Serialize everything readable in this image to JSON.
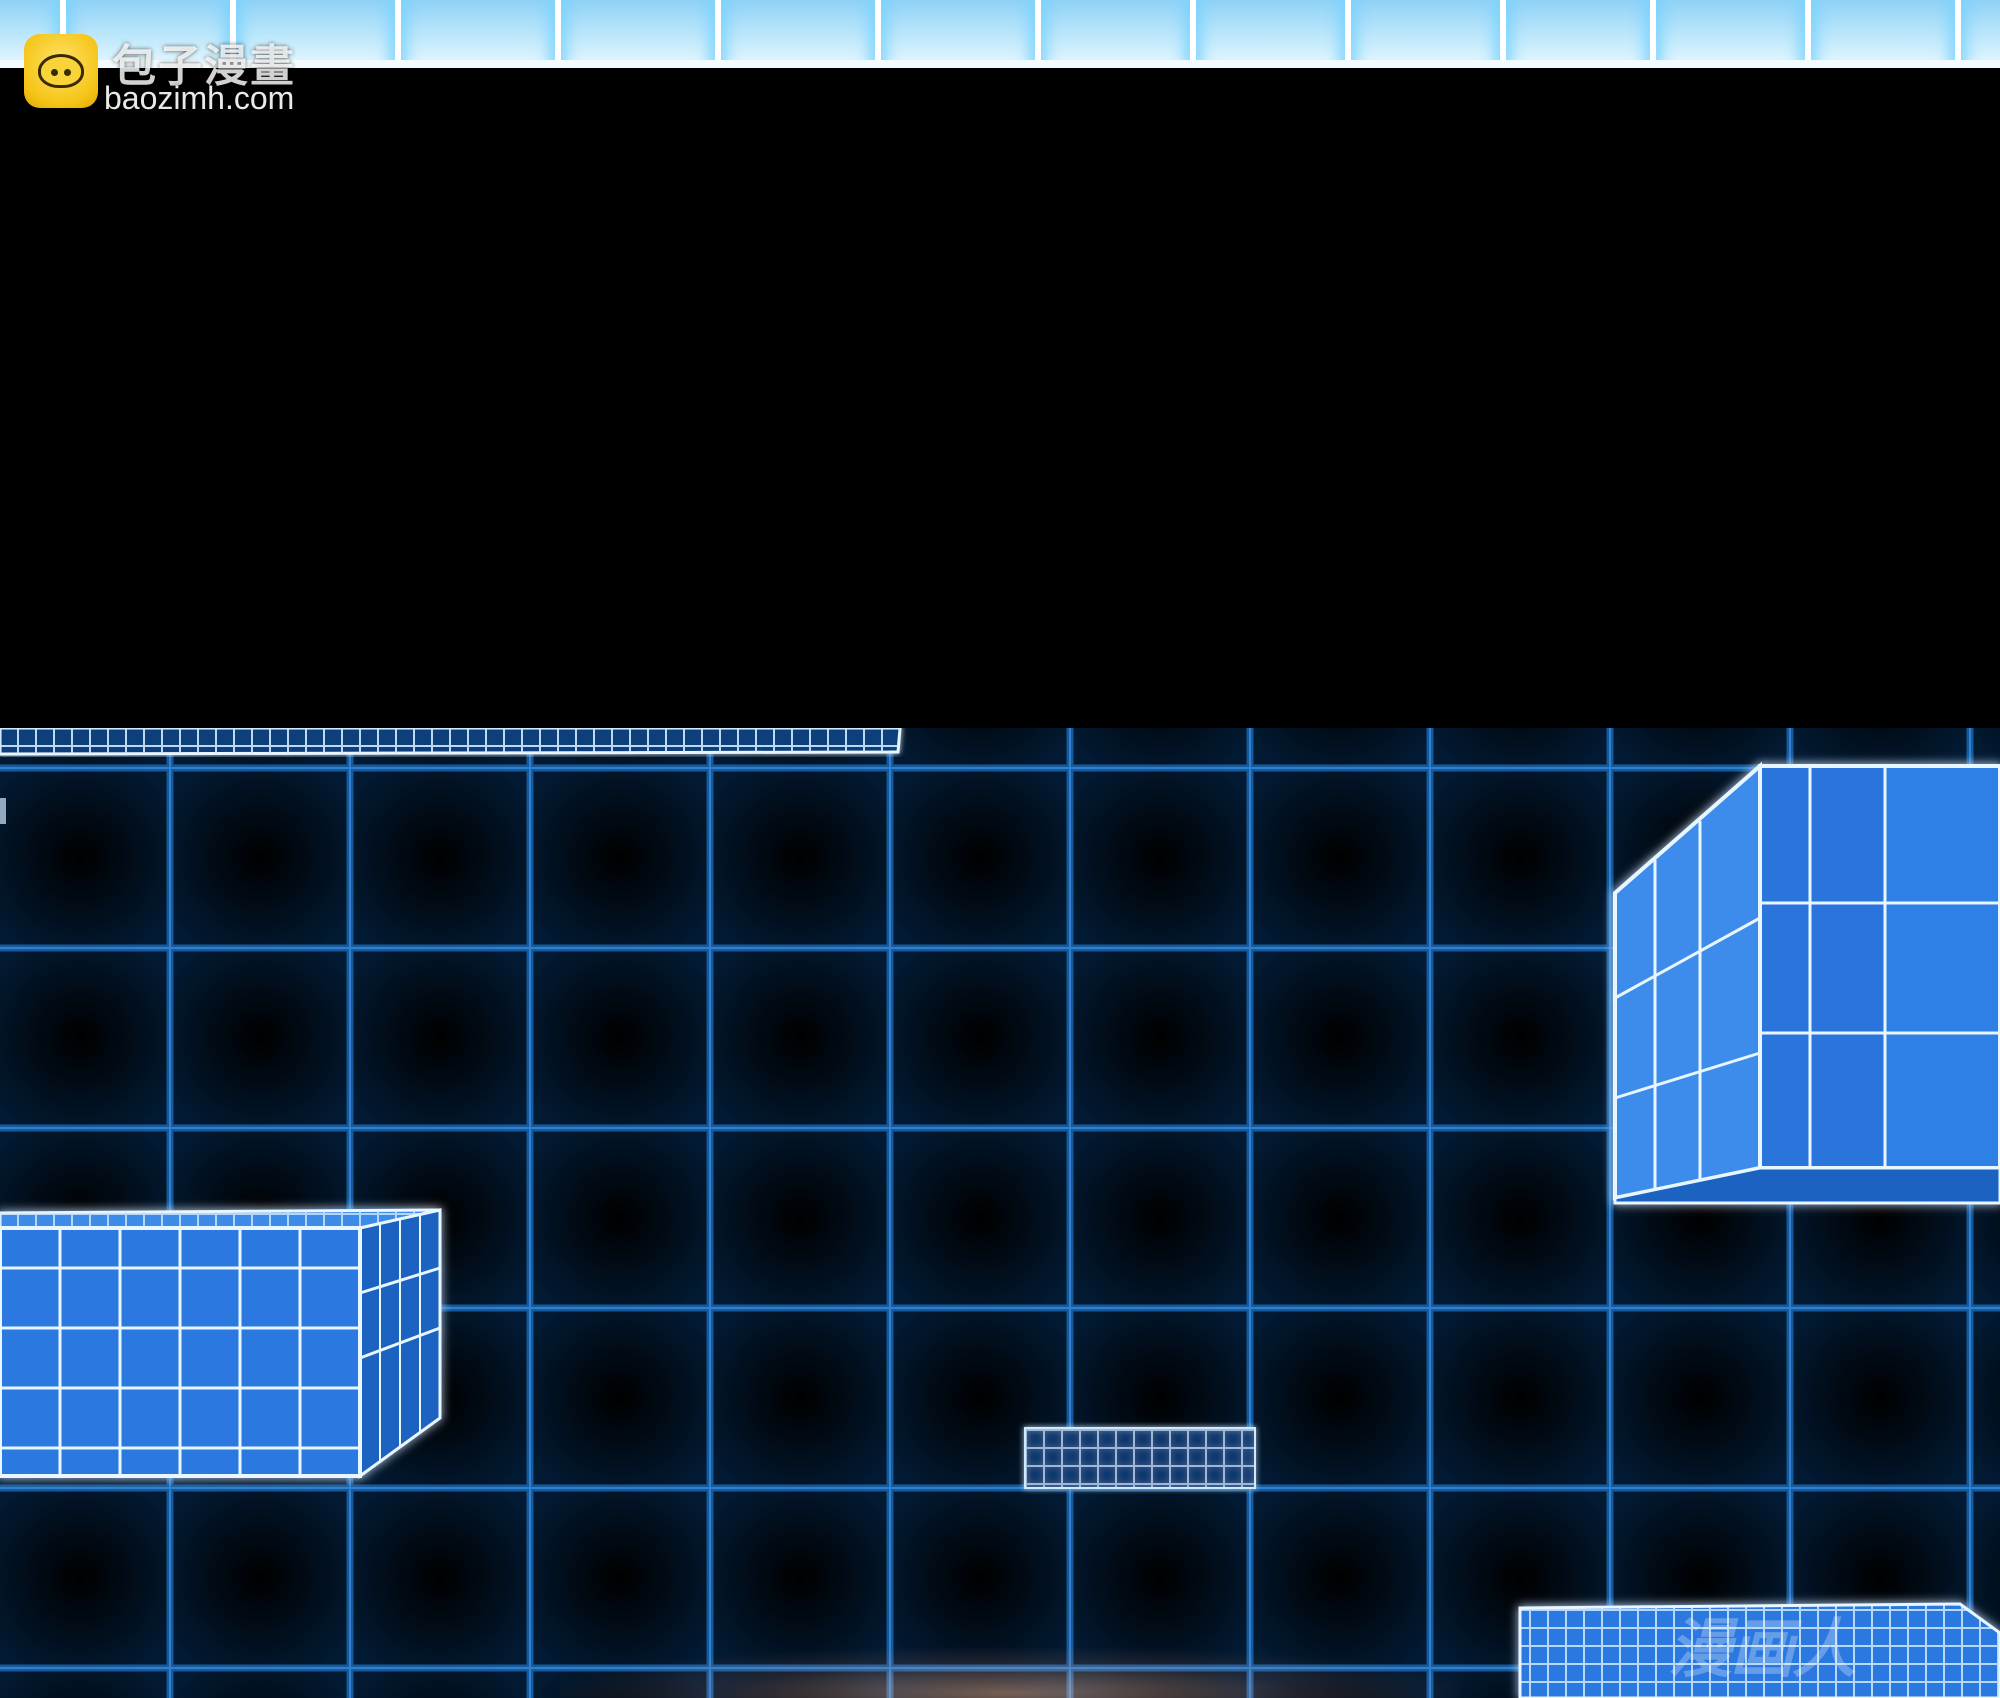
{
  "watermark": {
    "cn": "包子漫畫",
    "en": "baozimh.com",
    "bottom_mark": "漫画人"
  },
  "colors": {
    "grid_line": "#1a6fc0",
    "cube_fill": "#2a78e0",
    "cube_edge": "#e8f6ff",
    "background": "#00060f"
  }
}
